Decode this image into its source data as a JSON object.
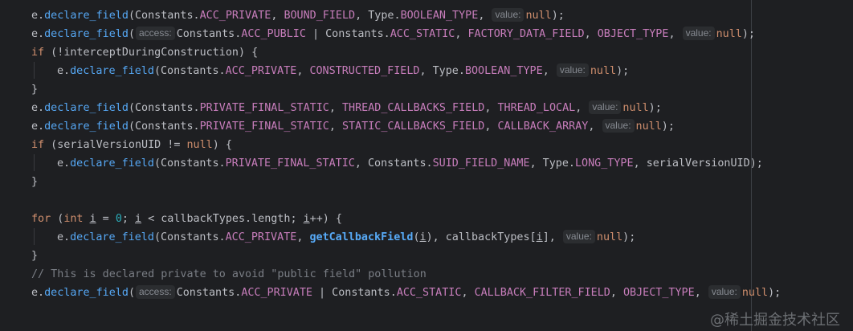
{
  "editor": {
    "lines": [
      {
        "indent": 1,
        "tokens": [
          {
            "c": "cls",
            "t": "e."
          },
          {
            "c": "fn",
            "t": "declare_field"
          },
          {
            "c": "cls",
            "t": "(Constants."
          },
          {
            "c": "const",
            "t": "ACC_PRIVATE"
          },
          {
            "c": "cls",
            "t": ", "
          },
          {
            "c": "const",
            "t": "BOUND_FIELD"
          },
          {
            "c": "cls",
            "t": ", Type."
          },
          {
            "c": "const",
            "t": "BOOLEAN_TYPE"
          },
          {
            "c": "cls",
            "t": ", "
          },
          {
            "c": "inlay",
            "t": "value:"
          },
          {
            "c": "kw",
            "t": "null"
          },
          {
            "c": "cls",
            "t": ");"
          }
        ]
      },
      {
        "indent": 1,
        "tokens": [
          {
            "c": "cls",
            "t": "e."
          },
          {
            "c": "fn",
            "t": "declare_field"
          },
          {
            "c": "cls",
            "t": "("
          },
          {
            "c": "inlay",
            "t": "access:"
          },
          {
            "c": "cls",
            "t": "Constants."
          },
          {
            "c": "const",
            "t": "ACC_PUBLIC"
          },
          {
            "c": "cls",
            "t": " | Constants."
          },
          {
            "c": "const",
            "t": "ACC_STATIC"
          },
          {
            "c": "cls",
            "t": ", "
          },
          {
            "c": "const",
            "t": "FACTORY_DATA_FIELD"
          },
          {
            "c": "cls",
            "t": ", "
          },
          {
            "c": "const",
            "t": "OBJECT_TYPE"
          },
          {
            "c": "cls",
            "t": ", "
          },
          {
            "c": "inlay",
            "t": "value:"
          },
          {
            "c": "kw",
            "t": "null"
          },
          {
            "c": "cls",
            "t": ");"
          }
        ]
      },
      {
        "indent": 1,
        "tokens": [
          {
            "c": "kw",
            "t": "if"
          },
          {
            "c": "cls",
            "t": " (!"
          },
          {
            "c": "param",
            "t": "interceptDuringConstruction"
          },
          {
            "c": "cls",
            "t": ") {"
          }
        ]
      },
      {
        "indent": 2,
        "tokens": [
          {
            "c": "cls",
            "t": "e."
          },
          {
            "c": "fn",
            "t": "declare_field"
          },
          {
            "c": "cls",
            "t": "(Constants."
          },
          {
            "c": "const",
            "t": "ACC_PRIVATE"
          },
          {
            "c": "cls",
            "t": ", "
          },
          {
            "c": "const",
            "t": "CONSTRUCTED_FIELD"
          },
          {
            "c": "cls",
            "t": ", Type."
          },
          {
            "c": "const",
            "t": "BOOLEAN_TYPE"
          },
          {
            "c": "cls",
            "t": ", "
          },
          {
            "c": "inlay",
            "t": "value:"
          },
          {
            "c": "kw",
            "t": "null"
          },
          {
            "c": "cls",
            "t": ");"
          }
        ]
      },
      {
        "indent": 1,
        "tokens": [
          {
            "c": "cls",
            "t": "}"
          }
        ]
      },
      {
        "indent": 1,
        "tokens": [
          {
            "c": "cls",
            "t": "e."
          },
          {
            "c": "fn",
            "t": "declare_field"
          },
          {
            "c": "cls",
            "t": "(Constants."
          },
          {
            "c": "const",
            "t": "PRIVATE_FINAL_STATIC"
          },
          {
            "c": "cls",
            "t": ", "
          },
          {
            "c": "const",
            "t": "THREAD_CALLBACKS_FIELD"
          },
          {
            "c": "cls",
            "t": ", "
          },
          {
            "c": "const",
            "t": "THREAD_LOCAL"
          },
          {
            "c": "cls",
            "t": ", "
          },
          {
            "c": "inlay",
            "t": "value:"
          },
          {
            "c": "kw",
            "t": "null"
          },
          {
            "c": "cls",
            "t": ");"
          }
        ]
      },
      {
        "indent": 1,
        "tokens": [
          {
            "c": "cls",
            "t": "e."
          },
          {
            "c": "fn",
            "t": "declare_field"
          },
          {
            "c": "cls",
            "t": "(Constants."
          },
          {
            "c": "const",
            "t": "PRIVATE_FINAL_STATIC"
          },
          {
            "c": "cls",
            "t": ", "
          },
          {
            "c": "const",
            "t": "STATIC_CALLBACKS_FIELD"
          },
          {
            "c": "cls",
            "t": ", "
          },
          {
            "c": "const",
            "t": "CALLBACK_ARRAY"
          },
          {
            "c": "cls",
            "t": ", "
          },
          {
            "c": "inlay",
            "t": "value:"
          },
          {
            "c": "kw",
            "t": "null"
          },
          {
            "c": "cls",
            "t": ");"
          }
        ]
      },
      {
        "indent": 1,
        "tokens": [
          {
            "c": "kw",
            "t": "if"
          },
          {
            "c": "cls",
            "t": " ("
          },
          {
            "c": "param",
            "t": "serialVersionUID"
          },
          {
            "c": "cls",
            "t": " != "
          },
          {
            "c": "kw",
            "t": "null"
          },
          {
            "c": "cls",
            "t": ") {"
          }
        ]
      },
      {
        "indent": 2,
        "tokens": [
          {
            "c": "cls",
            "t": "e."
          },
          {
            "c": "fn",
            "t": "declare_field"
          },
          {
            "c": "cls",
            "t": "(Constants."
          },
          {
            "c": "const",
            "t": "PRIVATE_FINAL_STATIC"
          },
          {
            "c": "cls",
            "t": ", Constants."
          },
          {
            "c": "const",
            "t": "SUID_FIELD_NAME"
          },
          {
            "c": "cls",
            "t": ", Type."
          },
          {
            "c": "const",
            "t": "LONG_TYPE"
          },
          {
            "c": "cls",
            "t": ", "
          },
          {
            "c": "param",
            "t": "serialVersionUID"
          },
          {
            "c": "cls",
            "t": ");"
          }
        ]
      },
      {
        "indent": 1,
        "tokens": [
          {
            "c": "cls",
            "t": "}"
          }
        ]
      },
      {
        "indent": 0,
        "tokens": []
      },
      {
        "indent": 1,
        "tokens": [
          {
            "c": "kw",
            "t": "for"
          },
          {
            "c": "cls",
            "t": " ("
          },
          {
            "c": "kw",
            "t": "int"
          },
          {
            "c": "cls",
            "t": " "
          },
          {
            "c": "ul",
            "t": "i"
          },
          {
            "c": "cls",
            "t": " = "
          },
          {
            "c": "num",
            "t": "0"
          },
          {
            "c": "cls",
            "t": "; "
          },
          {
            "c": "ul",
            "t": "i"
          },
          {
            "c": "cls",
            "t": " < callbackTypes.length; "
          },
          {
            "c": "ul",
            "t": "i"
          },
          {
            "c": "cls",
            "t": "++) {"
          }
        ]
      },
      {
        "indent": 2,
        "tokens": [
          {
            "c": "cls",
            "t": "e."
          },
          {
            "c": "fn",
            "t": "declare_field"
          },
          {
            "c": "cls",
            "t": "(Constants."
          },
          {
            "c": "const",
            "t": "ACC_PRIVATE"
          },
          {
            "c": "cls",
            "t": ", "
          },
          {
            "c": "bold-call",
            "t": "getCallbackField"
          },
          {
            "c": "cls",
            "t": "("
          },
          {
            "c": "ul",
            "t": "i"
          },
          {
            "c": "cls",
            "t": "), callbackTypes["
          },
          {
            "c": "ul",
            "t": "i"
          },
          {
            "c": "cls",
            "t": "], "
          },
          {
            "c": "inlay",
            "t": "value:"
          },
          {
            "c": "kw",
            "t": "null"
          },
          {
            "c": "cls",
            "t": ");"
          }
        ]
      },
      {
        "indent": 1,
        "tokens": [
          {
            "c": "cls",
            "t": "}"
          }
        ]
      },
      {
        "indent": 1,
        "tokens": [
          {
            "c": "cmt",
            "t": "// This is declared private to avoid \"public field\" pollution"
          }
        ]
      },
      {
        "indent": 1,
        "tokens": [
          {
            "c": "cls",
            "t": "e."
          },
          {
            "c": "fn",
            "t": "declare_field"
          },
          {
            "c": "cls",
            "t": "("
          },
          {
            "c": "inlay",
            "t": "access:"
          },
          {
            "c": "cls",
            "t": "Constants."
          },
          {
            "c": "const",
            "t": "ACC_PRIVATE"
          },
          {
            "c": "cls",
            "t": " | Constants."
          },
          {
            "c": "const",
            "t": "ACC_STATIC"
          },
          {
            "c": "cls",
            "t": ", "
          },
          {
            "c": "const",
            "t": "CALLBACK_FILTER_FIELD"
          },
          {
            "c": "cls",
            "t": ", "
          },
          {
            "c": "const",
            "t": "OBJECT_TYPE"
          },
          {
            "c": "cls",
            "t": ", "
          },
          {
            "c": "inlay",
            "t": "value:"
          },
          {
            "c": "kw",
            "t": "null"
          },
          {
            "c": "cls",
            "t": ");"
          }
        ]
      }
    ]
  },
  "watermark": "@稀土掘金技术社区",
  "colors": {
    "background": "#1e1f22",
    "keyword": "#cf8e6d",
    "function": "#56a8f5",
    "constant": "#c77dbb",
    "comment": "#7a7e85",
    "number": "#2aacb8",
    "text": "#bcbec4"
  }
}
